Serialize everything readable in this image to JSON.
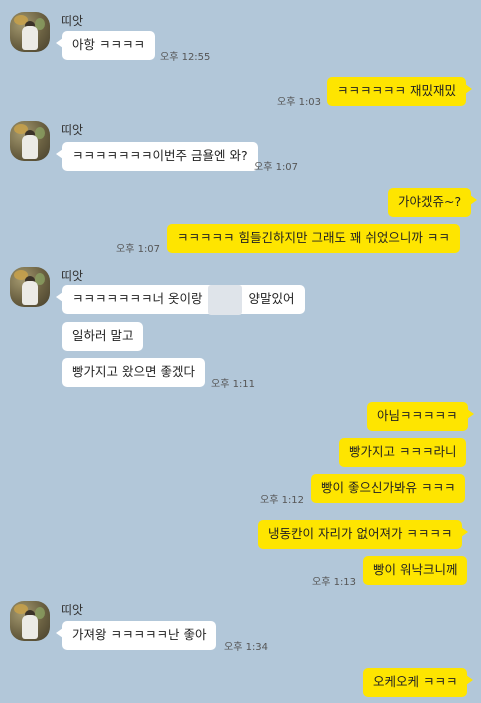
{
  "messages": {
    "m1": {
      "sender": "띠앗",
      "text": "아항 ㅋㅋㅋㅋ",
      "time": "오후 12:55"
    },
    "m2": {
      "text": "ㅋㅋㅋㅋㅋㅋ 재밌재밌",
      "time": "오후 1:03"
    },
    "m3": {
      "sender": "띠앗",
      "text": "ㅋㅋㅋㅋㅋㅋㅋ이번주 금욜엔 와?",
      "time": "오후 1:07"
    },
    "m4": {
      "text": "가야겠쥬~?"
    },
    "m5": {
      "text": "ㅋㅋㅋㅋㅋ 힘들긴하지만 그래도 꽤 쉬었으니까 ㅋㅋ",
      "time": "오후 1:07"
    },
    "m6": {
      "sender": "띠앗",
      "text_a": "ㅋㅋㅋㅋㅋㅋㅋ너 옷이랑",
      "text_b": "양말있어"
    },
    "m7": {
      "text": "일하러 말고"
    },
    "m8": {
      "text": "빵가지고 왔으면 좋겠다",
      "time": "오후 1:11"
    },
    "m9": {
      "text": "아님ㅋㅋㅋㅋㅋ"
    },
    "m10": {
      "text": "빵가지고 ㅋㅋㅋ라니"
    },
    "m11": {
      "text": "빵이 좋으신가봐유 ㅋㅋㅋ",
      "time": "오후 1:12"
    },
    "m12": {
      "text": "냉동칸이 자리가 없어져가 ㅋㅋㅋㅋ"
    },
    "m13": {
      "text": "빵이 워낙크니께",
      "time": "오후 1:13"
    },
    "m14": {
      "sender": "띠앗",
      "text": "가져왕 ㅋㅋㅋㅋㅋ난 좋아",
      "time": "오후 1:34"
    },
    "m15": {
      "text": "오케오케 ㅋㅋㅋ"
    }
  },
  "colors": {
    "background": "#b2c7d9",
    "outgoing_bubble": "#fee500",
    "incoming_bubble": "#ffffff"
  }
}
